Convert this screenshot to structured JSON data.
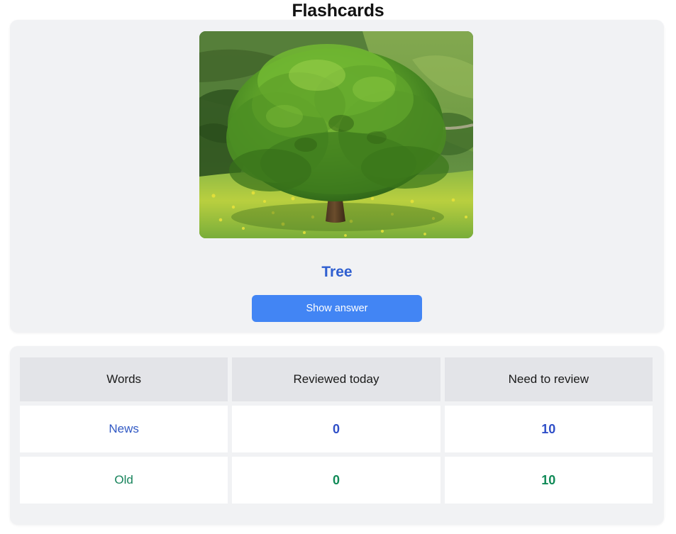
{
  "page": {
    "title": "Flashcards"
  },
  "flashcard": {
    "image_alt": "tree-photo",
    "word": "Tree",
    "show_answer_label": "Show answer"
  },
  "stats": {
    "headers": [
      "Words",
      "Reviewed today",
      "Need to review"
    ],
    "rows": [
      {
        "label": "News",
        "reviewed_today": "0",
        "need_to_review": "10",
        "color": "#2f4fc8"
      },
      {
        "label": "Old",
        "reviewed_today": "0",
        "need_to_review": "10",
        "color": "#108a57"
      }
    ]
  },
  "colors": {
    "accent_blue": "#4285f4",
    "word_blue": "#2f5fd0",
    "news_blue": "#3159c4",
    "old_green": "#17835b",
    "card_bg": "#f1f2f4",
    "header_cell_bg": "#e3e4e8",
    "page_bg": "#ffffff"
  }
}
